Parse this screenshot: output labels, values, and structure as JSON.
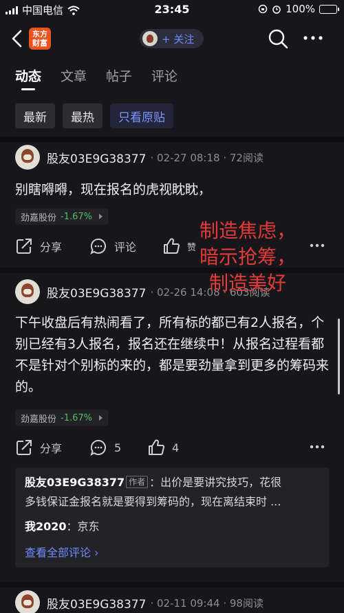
{
  "status_bar": {
    "carrier": "中国电信",
    "time": "23:45",
    "battery": "100%"
  },
  "nav": {
    "logo_line1": "东方",
    "logo_line2": "财富",
    "follow_label": "+ 关注"
  },
  "tabs": [
    {
      "label": "动态",
      "active": true
    },
    {
      "label": "文章",
      "active": false
    },
    {
      "label": "帖子",
      "active": false
    },
    {
      "label": "评论",
      "active": false
    }
  ],
  "filters": [
    {
      "label": "最新",
      "active": false
    },
    {
      "label": "最热",
      "active": false
    },
    {
      "label": "只看原贴",
      "active": true
    }
  ],
  "posts": [
    {
      "user": "股友03E9G38377",
      "meta": "· 02-27 08:18 · 72阅读",
      "text": "别瞎嘚嘚，现在报名的虎视眈眈，",
      "stock_name": "劲嘉股份",
      "stock_change": "-1.67%",
      "share_label": "分享",
      "comment_label": "评论",
      "like_label": "赞"
    },
    {
      "user": "股友03E9G38377",
      "meta": "· 02-26 14:08 · 603阅读",
      "text": "下午收盘后有热闹看了，所有标的都已有2人报名，个别已经有3人报名，报名还在继续中！从报名过程看都不是针对个别标的来的，都是要劲量拿到更多的筹码来的。",
      "stock_name": "劲嘉股份",
      "stock_change": "-1.67%",
      "share_label": "分享",
      "comment_label": "5",
      "like_label": "4",
      "comments": {
        "c1_author": "股友03E9G38377",
        "c1_tag": "作者",
        "c1_text": "：出价是要讲究技巧，花很",
        "c1_text2": "多钱保证金报名就是要得到筹码的，现在离结束时 ...",
        "c2_author": "我2020",
        "c2_text": "：京东",
        "view_all": "查看全部评论 ›"
      }
    },
    {
      "user": "股友03E9G38377",
      "meta": "· 02-11 09:44 · 98阅读"
    }
  ],
  "overlay_text": {
    "line1": "制造焦虑，",
    "line2": "暗示抢筹，",
    "line3": "制造美好"
  },
  "colors": {
    "accent": "#6f8cff",
    "overlay": "#e53a3a",
    "stock_change": "#4fbf67",
    "logo": "#e8531e"
  }
}
